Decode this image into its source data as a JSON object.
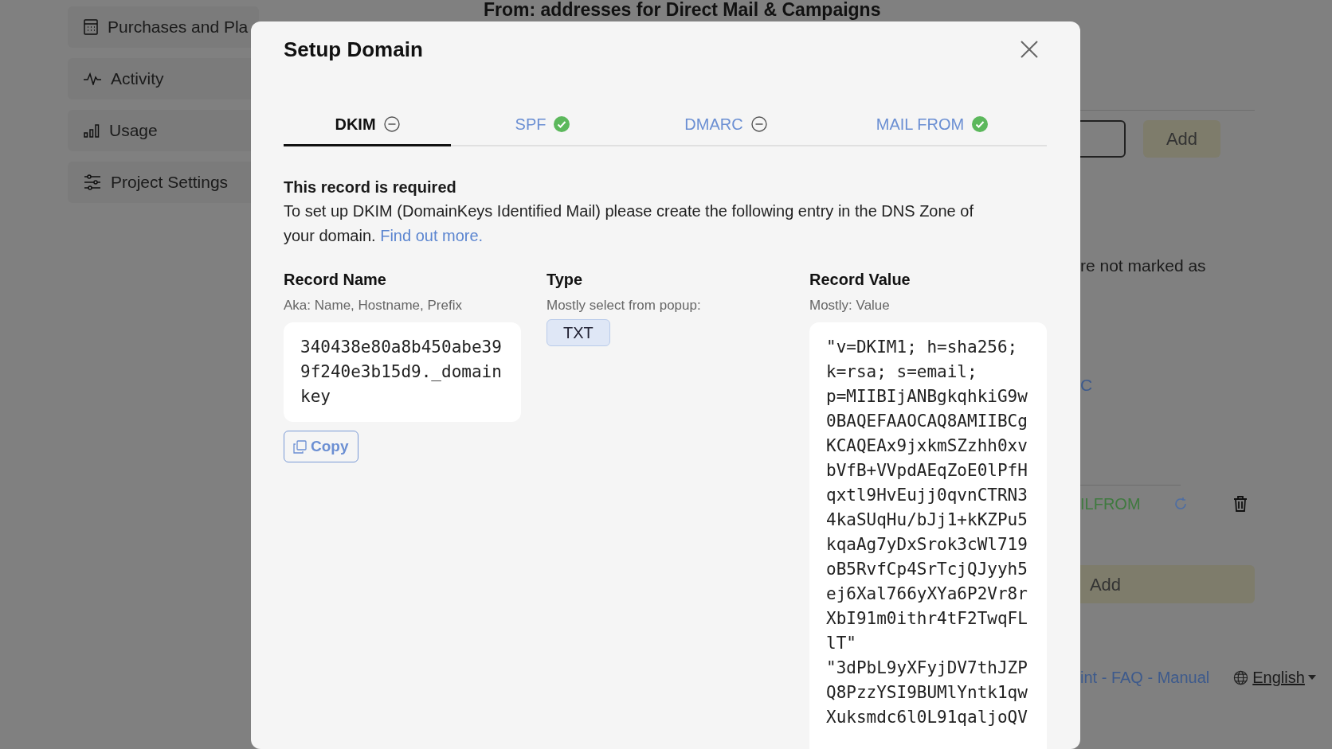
{
  "background": {
    "heading": "From: addresses for Direct Mail & Campaigns",
    "sidebar_items": [
      "Purchases and Pla",
      "Activity",
      "Usage",
      "Project Settings"
    ],
    "add_button_top": "Add",
    "note_text": "re not marked as",
    "link_text": "C",
    "record_status": "ILFROM",
    "add_button": "Add",
    "footer_links": "int - FAQ - Manual",
    "language": "English"
  },
  "modal": {
    "title": "Setup Domain",
    "tabs": [
      {
        "label": "DKIM",
        "selected": true,
        "verified": false
      },
      {
        "label": "SPF",
        "selected": false,
        "verified": true
      },
      {
        "label": "DMARC",
        "selected": false,
        "verified": false
      },
      {
        "label": "MAIL FROM",
        "selected": false,
        "verified": true
      }
    ],
    "required_title": "This record is required",
    "description": "To set up DKIM (DomainKeys Identified Mail) please create the following entry in the DNS Zone of your domain.",
    "link": "Find out more.",
    "columns": [
      {
        "kind": "value",
        "heading": "Record Name",
        "hint": "Aka: Name, Hostname, Prefix",
        "value": "340438e80a8b450abe399f240e3b15d9._domainkey",
        "copy_button": "Copy"
      },
      {
        "kind": "badge",
        "heading": "Type",
        "hint": "Mostly select from popup:",
        "value": "TXT"
      },
      {
        "kind": "value",
        "heading": "Record Value",
        "hint": "Mostly: Value",
        "value": "\"v=DKIM1; h=sha256; k=rsa; s=email; p=MIIBIjANBgkqhkiG9w0BAQEFAAOCAQ8AMIIBCgKCAQEAx9jxkmSZzhh0xvbVfB+VVpdAEqZoE0lPfHqxtl9HvEujj0qvnCTRN34kaSUqHu/bJj1+kKZPu5kqaAg7yDxSrok3cWl719oB5RvfCp4SrTcjQJyyh5ej6Xal766yXYa6P2Vr8rXbI91m0ithr4tF2TwqFLlT\" \"3dPbL9yXFyjDV7thJZPQ8PzzYSI9BUMlYntk1qwXuksmdc6l0L91qaljoQV"
      }
    ]
  }
}
